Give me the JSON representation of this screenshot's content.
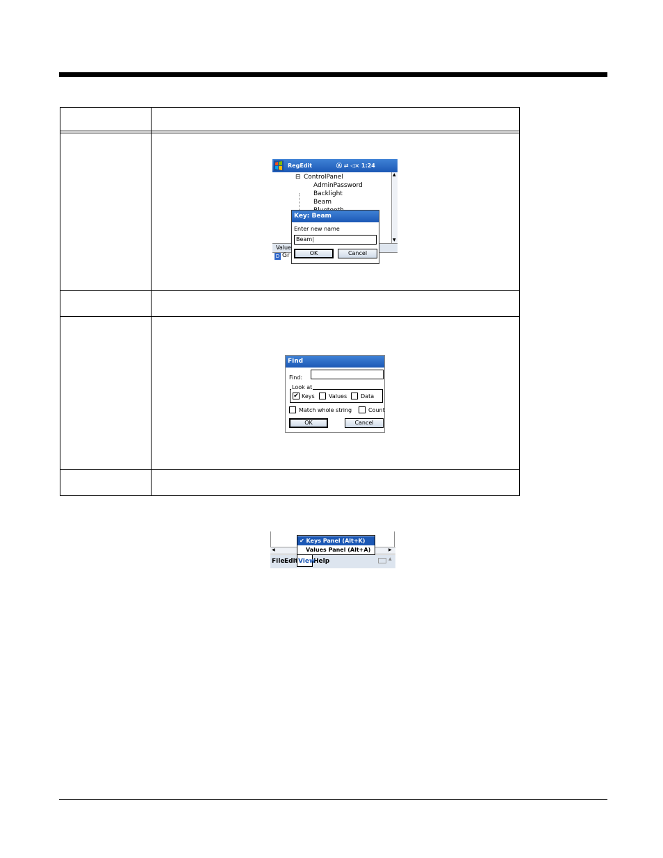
{
  "screens": {
    "regedit": {
      "app_title": "RegEdit",
      "tray": "Ⓐ ⇄ ◁× 1:24",
      "tree": [
        "ControlPanel",
        "AdminPassword",
        "Backlight",
        "Beam",
        "Bluetooth"
      ],
      "values_header": "Value",
      "values_row": "Gr",
      "dialog": {
        "title": "Key: Beam",
        "label": "Enter new name",
        "value": "Beam|",
        "ok": "OK",
        "cancel": "Cancel"
      }
    },
    "find": {
      "title": "Find",
      "find_label": "Find:",
      "look_at": "Look at",
      "keys": "Keys",
      "values": "Values",
      "data": "Data",
      "match_whole": "Match whole string",
      "count": "Count",
      "ok": "OK",
      "cancel": "Cancel"
    },
    "view_menu": {
      "item1": "✔ Keys Panel    (Alt+K)",
      "item2": "Values Panel  (Alt+A)",
      "menubar": [
        "File",
        "Edit",
        "View",
        "Help"
      ]
    }
  }
}
